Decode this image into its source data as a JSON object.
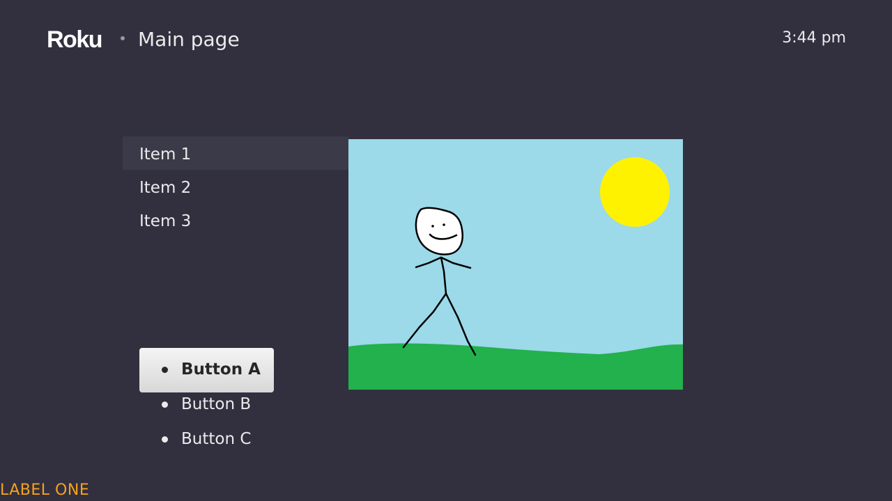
{
  "header": {
    "logo": "Roku",
    "title": "Main page",
    "clock": "3:44 pm"
  },
  "list": {
    "items": [
      {
        "label": "Item 1",
        "focused": true
      },
      {
        "label": "Item 2",
        "focused": false
      },
      {
        "label": "Item 3",
        "focused": false
      }
    ]
  },
  "picture": {
    "sky_color": "#9cd9e9",
    "sun_color": "#fff200",
    "grass_color": "#22b14c",
    "stroke_color": "#000000"
  },
  "buttons": [
    {
      "label": "Button A",
      "focused": true
    },
    {
      "label": "Button B",
      "focused": false
    },
    {
      "label": "Button C",
      "focused": false
    }
  ],
  "bottom_label": "LABEL ONE",
  "colors": {
    "background": "#32303f",
    "text": "#ebebeb",
    "accent": "#f7a21b",
    "focus_row": "#3b3a48"
  }
}
